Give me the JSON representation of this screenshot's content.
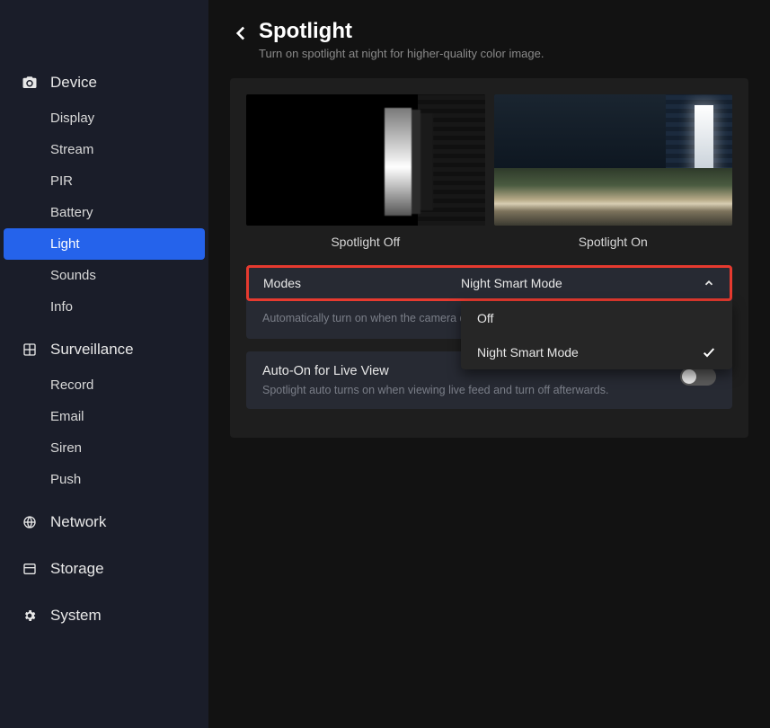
{
  "sidebar": {
    "device": {
      "label": "Device",
      "items": [
        {
          "label": "Display"
        },
        {
          "label": "Stream"
        },
        {
          "label": "PIR"
        },
        {
          "label": "Battery"
        },
        {
          "label": "Light",
          "selected": true
        },
        {
          "label": "Sounds"
        },
        {
          "label": "Info"
        }
      ]
    },
    "surveillance": {
      "label": "Surveillance",
      "items": [
        {
          "label": "Record"
        },
        {
          "label": "Email"
        },
        {
          "label": "Siren"
        },
        {
          "label": "Push"
        }
      ]
    },
    "network": {
      "label": "Network"
    },
    "storage": {
      "label": "Storage"
    },
    "system": {
      "label": "System"
    }
  },
  "page": {
    "title": "Spotlight",
    "subtitle": "Turn on spotlight at night for higher-quality color image."
  },
  "previews": {
    "off_label": "Spotlight Off",
    "on_label": "Spotlight On"
  },
  "modes": {
    "label": "Modes",
    "selected": "Night Smart Mode",
    "description_truncated": "Automatically turn on when the camera d",
    "options": [
      {
        "label": "Off",
        "checked": false
      },
      {
        "label": "Night Smart Mode",
        "checked": true
      }
    ]
  },
  "auto_on": {
    "title": "Auto-On for Live View",
    "description": "Spotlight auto turns on when viewing live feed and turn off afterwards.",
    "enabled": false
  },
  "colors": {
    "accent": "#2563eb",
    "highlight_border": "#e63a2f"
  }
}
